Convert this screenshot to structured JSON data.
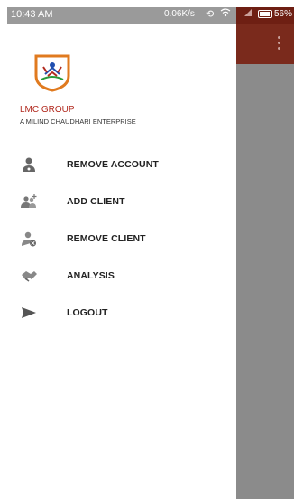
{
  "status_bar": {
    "time": "10:43 AM",
    "network_speed": "0.06K/s",
    "battery": "56%"
  },
  "header": {
    "brand": "LMC GROUP",
    "tagline": "A MILIND CHAUDHARI ENTERPRISE"
  },
  "menu": {
    "items": [
      {
        "label": "REMOVE ACCOUNT",
        "icon": "person-icon"
      },
      {
        "label": "ADD CLIENT",
        "icon": "add-group-icon"
      },
      {
        "label": "REMOVE CLIENT",
        "icon": "remove-person-icon"
      },
      {
        "label": "ANALYSIS",
        "icon": "handshake-icon"
      },
      {
        "label": "LOGOUT",
        "icon": "send-icon"
      }
    ]
  },
  "colors": {
    "brand_red": "#b22a1f",
    "toolbar": "#7a2a1c",
    "scrim": "#8b8b8b"
  }
}
